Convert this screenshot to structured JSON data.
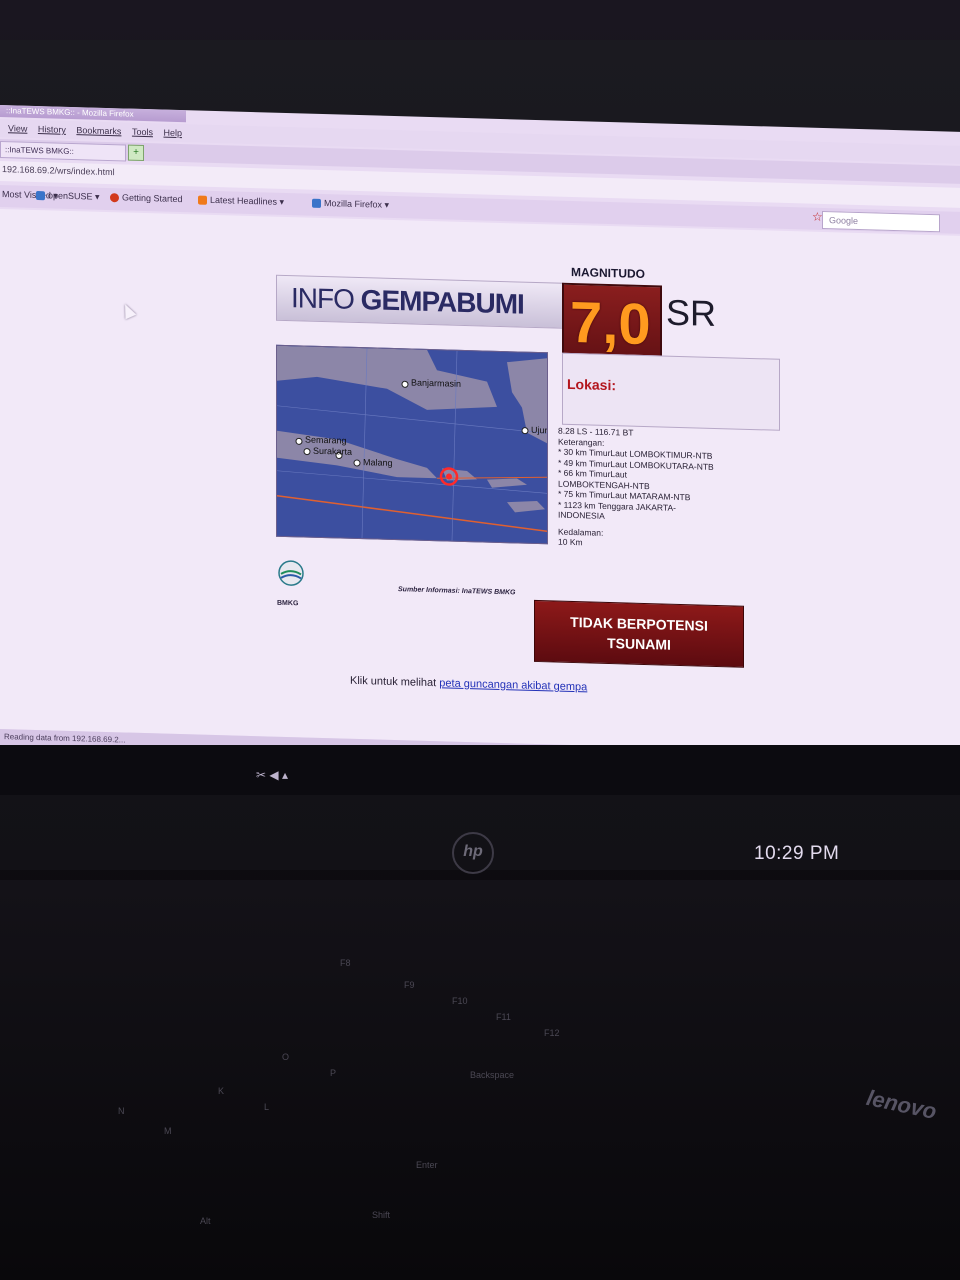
{
  "browser": {
    "window_title": "::InaTEWS BMKG:: - Mozilla Firefox",
    "menu": [
      "View",
      "History",
      "Bookmarks",
      "Tools",
      "Help"
    ],
    "tab_label": "::InaTEWS BMKG::",
    "url": "192.168.69.2/wrs/index.html",
    "bookmarks": [
      "Most Visited",
      "openSUSE",
      "Getting Started",
      "Latest Headlines",
      "Mozilla Firefox"
    ],
    "search_placeholder": "Google",
    "status": "Reading data from 192.168.69.2..."
  },
  "page": {
    "header_prefix": "INFO",
    "header_strong": "GEMPABUMI",
    "magnitude_label": "MAGNITUDO",
    "magnitude_value": "7,0",
    "magnitude_unit": "SR",
    "lokasi_title": "Lokasi:",
    "coordinates": "8.28 LS - 116.71 BT",
    "keterangan_label": "Keterangan:",
    "keterangan": [
      "* 30 km TimurLaut LOMBOKTIMUR-NTB",
      "* 49 km TimurLaut LOMBOKUTARA-NTB",
      "* 66 km TimurLaut",
      "LOMBOKTENGAH-NTB",
      "* 75 km TimurLaut MATARAM-NTB",
      "* 1123 km Tenggara JAKARTA-",
      "INDONESIA"
    ],
    "kedalaman_label": "Kedalaman:",
    "kedalaman_value": "10 Km",
    "bmkg_label": "BMKG",
    "sumber": "Sumber Informasi: InaTEWS BMKG",
    "tsunami_line1": "TIDAK BERPOTENSI",
    "tsunami_line2": "TSUNAMI",
    "link_prefix": "Klik untuk melihat",
    "link_text": "peta guncangan akibat gempa",
    "map_cities": [
      "Banjarmasin",
      "Semarang",
      "Surakarta",
      "Malang",
      "Ujung"
    ]
  },
  "desktop": {
    "clock": "10:29 PM",
    "monitor_brand": "hp",
    "laptop_brand": "lenovo"
  },
  "keyboard_keys": [
    "F8",
    "F9",
    "F10",
    "F11",
    "F12",
    "Backspace",
    "Enter",
    "Shift",
    "P",
    "O",
    "L",
    "K",
    "M",
    "N",
    "Alt"
  ],
  "colors": {
    "magnitude_orange": "#ff9a1f",
    "warning_red": "#8d1919",
    "lokasi_red": "#b3151d",
    "header_navy": "#2a2a63"
  }
}
